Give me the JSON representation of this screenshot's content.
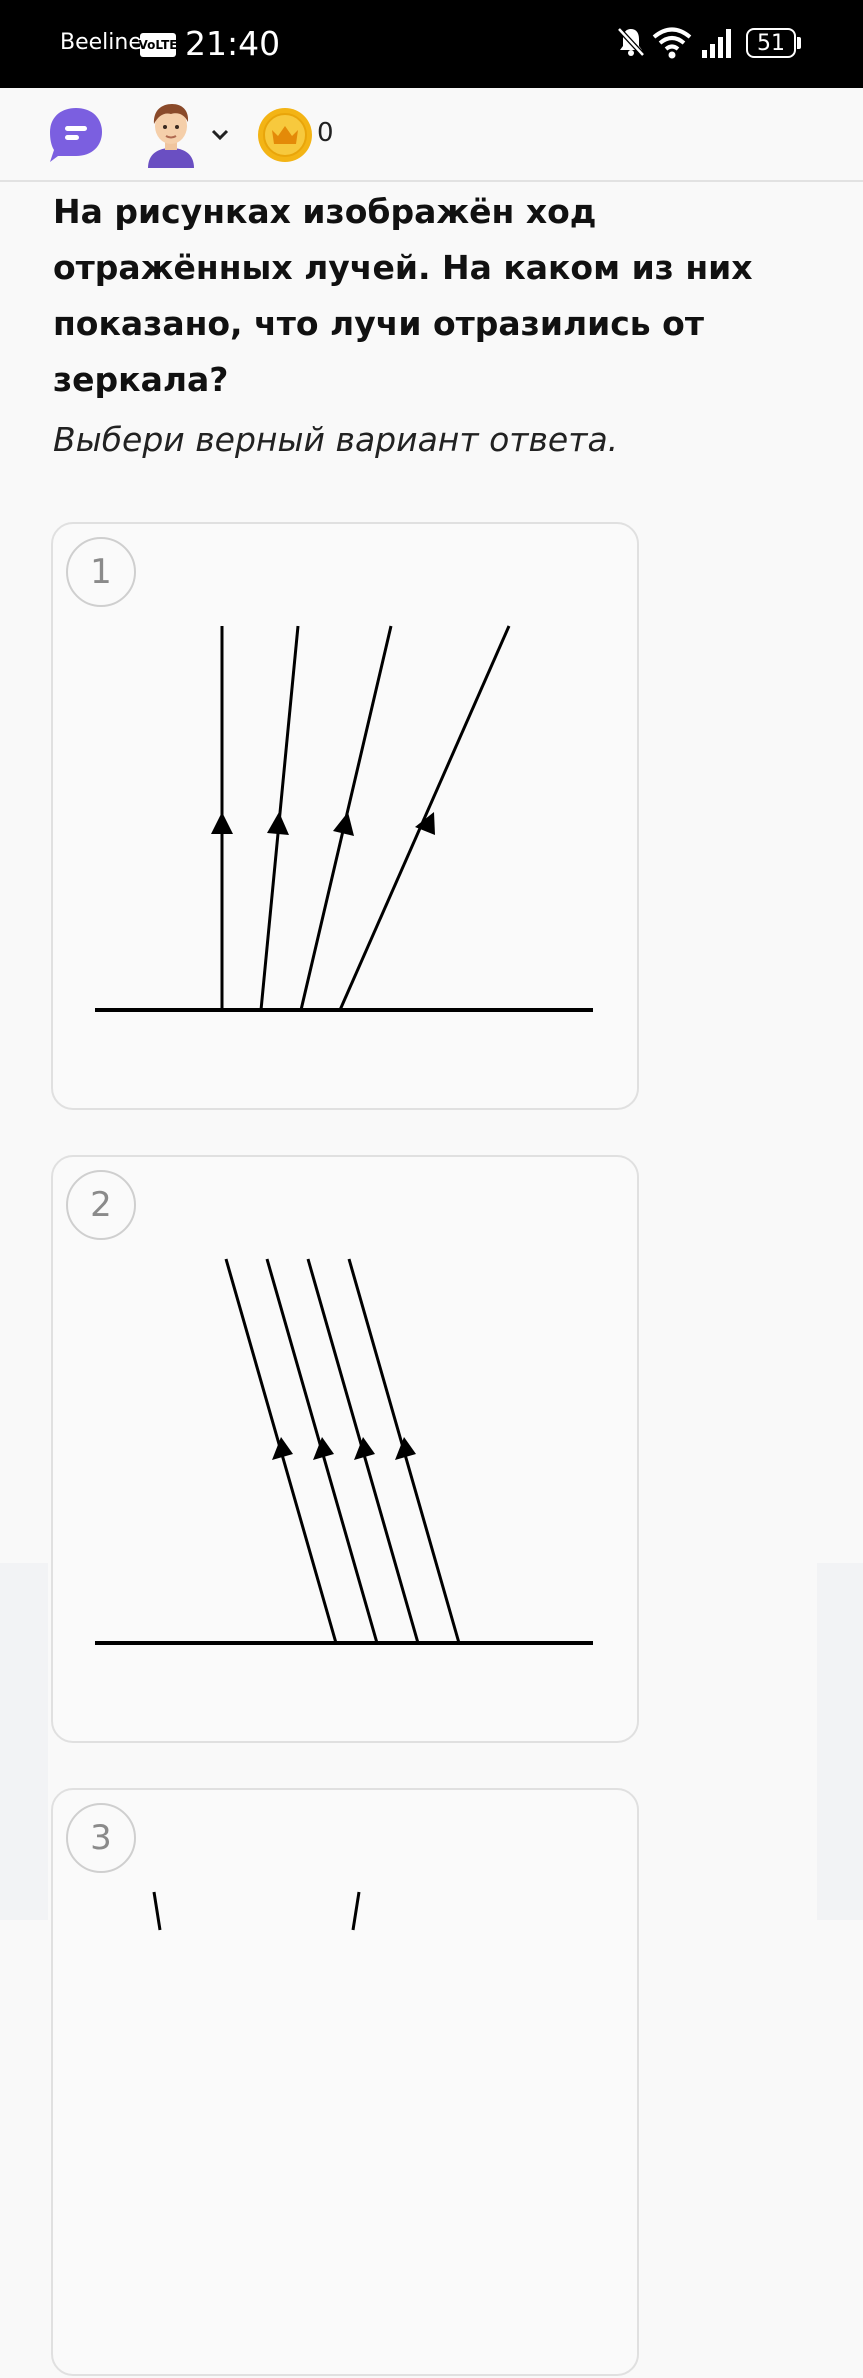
{
  "status_bar": {
    "carrier": "Beeline",
    "volte": "VoLTE",
    "time": "21:40",
    "battery": "51",
    "icons": [
      "bell-off-icon",
      "wifi-icon",
      "signal-icon",
      "battery-icon"
    ]
  },
  "header": {
    "icons": [
      "chat-icon",
      "avatar",
      "chevron-down-icon",
      "crown-coin-icon"
    ],
    "coins": "0",
    "accent_color": "#7b5fe0",
    "coin_color": "#f3b415"
  },
  "question": {
    "text": "На рисунках изображён ход отражённых лучей. На каком из них показано, что лучи отразились от зеркала?",
    "instruction": "Выбери верный вариант ответа."
  },
  "options": [
    {
      "number": "1",
      "description": "parallel-rays-diverging"
    },
    {
      "number": "2",
      "description": "parallel-rays-reflected"
    },
    {
      "number": "3",
      "description": "partially-visible"
    }
  ]
}
